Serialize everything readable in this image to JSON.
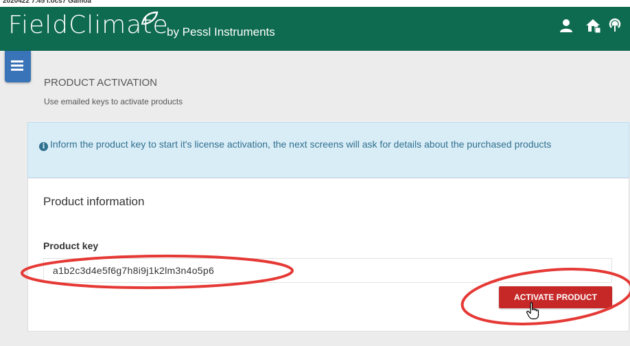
{
  "header": {
    "breadcrumb": "2020422 7.45 I.ocs7 Gamoa",
    "brand_name": "FieldClimate",
    "brand_tagline": "by Pessl Instruments",
    "icons": [
      "user-icon",
      "home-station-icon",
      "signal-icon"
    ]
  },
  "menu": {
    "icon": "hamburger-icon"
  },
  "page": {
    "title": "PRODUCT ACTIVATION",
    "subtitle": "Use emailed keys to activate products"
  },
  "info": {
    "icon": "info-circle-icon",
    "text": "Inform the product key to start it's license activation, the next screens will ask for details about the purchased products"
  },
  "form": {
    "section_title": "Product information",
    "product_key_label": "Product key",
    "product_key_value": "a1b2c3d4e5f6g7h8i9j1k2lm3n4o5p6",
    "activate_button": "ACTIVATE PRODUCT"
  },
  "colors": {
    "header_bg": "#0e6b4f",
    "menu_button": "#3a74b8",
    "info_bg": "#d9edf7",
    "info_text": "#31708f",
    "button_red": "#c62828",
    "annotation_red": "#e53935"
  }
}
